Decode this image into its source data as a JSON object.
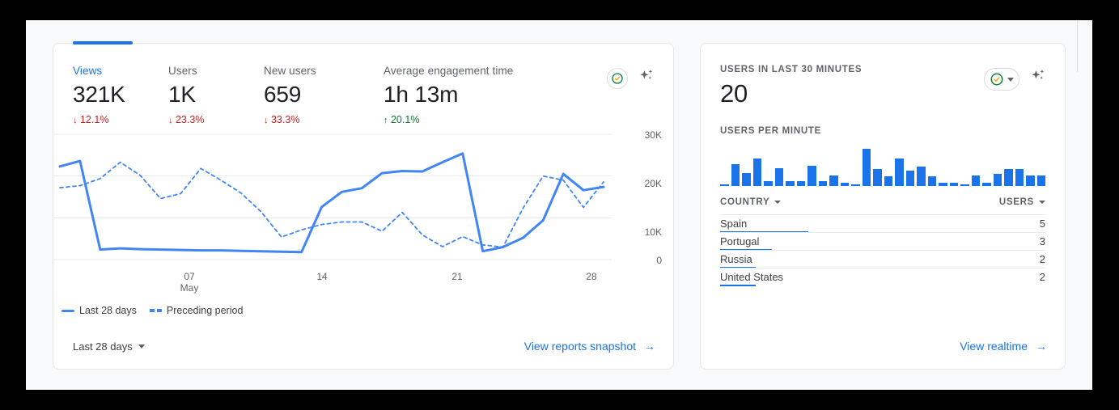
{
  "left_card": {
    "active_tab": "views",
    "metrics": [
      {
        "label": "Views",
        "value": "321K",
        "delta": "12.1%",
        "direction": "down",
        "arrow": "↓",
        "active": true
      },
      {
        "label": "Users",
        "value": "1K",
        "delta": "23.3%",
        "direction": "down",
        "arrow": "↓",
        "active": false
      },
      {
        "label": "New users",
        "value": "659",
        "delta": "33.3%",
        "direction": "down",
        "arrow": "↓",
        "active": false
      },
      {
        "label": "Average engagement time",
        "value": "1h 13m",
        "delta": "20.1%",
        "direction": "up",
        "arrow": "↑",
        "active": false
      }
    ],
    "icons": {
      "check": "check-circle-icon",
      "sparkle": "ai-sparkle-icon"
    },
    "legend": [
      {
        "label": "Last 28 days",
        "style": "solid"
      },
      {
        "label": "Preceding period",
        "style": "dashed"
      }
    ],
    "date_range": "Last 28 days",
    "footer_link": "View reports snapshot",
    "footer_link_arrow": "→"
  },
  "right_card": {
    "title": "USERS IN LAST 30 MINUTES",
    "value": "20",
    "subtitle": "USERS PER MINUTE",
    "icons": {
      "check": "check-circle-icon",
      "sparkle": "ai-sparkle-icon"
    },
    "table": {
      "columns": [
        "COUNTRY",
        "USERS"
      ],
      "rows": [
        {
          "country": "Spain",
          "users": "5",
          "bar_pct": 27
        },
        {
          "country": "Portugal",
          "users": "3",
          "bar_pct": 16
        },
        {
          "country": "Russia",
          "users": "2",
          "bar_pct": 11
        },
        {
          "country": "United States",
          "users": "2",
          "bar_pct": 11
        }
      ]
    },
    "footer_link": "View realtime",
    "footer_link_arrow": "→"
  },
  "colors": {
    "accent": "#1a73e8",
    "line": "#4285f4",
    "negative": "#c5221f",
    "positive": "#137333",
    "text": "#3c4043",
    "muted": "#5f6368",
    "page_bg": "#f8f9fa"
  },
  "chart_data": [
    {
      "type": "line",
      "title": "Views over time",
      "xlabel": "",
      "ylabel": "",
      "ylim": [
        0,
        30000
      ],
      "yticks": [
        0,
        10000,
        20000,
        30000
      ],
      "ytick_labels": [
        "0",
        "10K",
        "20K",
        "30K"
      ],
      "xticks": [
        6,
        13,
        20,
        27
      ],
      "xtick_labels": [
        "07",
        "14",
        "21",
        "28"
      ],
      "xtick_sublabel": "May",
      "grid": true,
      "legend_position": "bottom-left",
      "x": [
        0,
        1,
        2,
        3,
        4,
        5,
        6,
        7,
        8,
        9,
        10,
        11,
        12,
        13,
        14,
        15,
        16,
        17,
        18,
        19,
        20,
        21,
        22,
        23,
        24,
        25,
        26,
        27
      ],
      "series": [
        {
          "name": "Last 28 days",
          "style": "solid",
          "values": [
            22300,
            23600,
            2400,
            2700,
            2500,
            2400,
            2300,
            2200,
            2200,
            2100,
            2000,
            1900,
            1800,
            12600,
            16200,
            17100,
            20700,
            21200,
            21100,
            23300,
            25400,
            2000,
            3000,
            5200,
            9400,
            20500,
            16600,
            17400
          ]
        },
        {
          "name": "Preceding period",
          "style": "dashed",
          "values": [
            17200,
            17700,
            19400,
            23300,
            20100,
            14600,
            15800,
            21800,
            19000,
            15900,
            11400,
            5400,
            7100,
            8400,
            9000,
            9000,
            6800,
            11300,
            5900,
            3100,
            5500,
            3500,
            3000,
            12300,
            20000,
            19000,
            12500,
            18600
          ]
        }
      ]
    },
    {
      "type": "bar",
      "title": "Users per minute",
      "xlabel": "",
      "ylabel": "",
      "categories": [
        "1",
        "2",
        "3",
        "4",
        "5",
        "6",
        "7",
        "8",
        "9",
        "10",
        "11",
        "12",
        "13",
        "14",
        "15",
        "16",
        "17",
        "18",
        "19",
        "20",
        "21",
        "22",
        "23",
        "24",
        "25",
        "26",
        "27",
        "28",
        "29",
        "30"
      ],
      "values": [
        0,
        18,
        11,
        23,
        4,
        15,
        4,
        4,
        17,
        4,
        9,
        3,
        1,
        31,
        14,
        8,
        23,
        13,
        16,
        8,
        3,
        3,
        0,
        9,
        3,
        10,
        14,
        14,
        9,
        9
      ],
      "ylim": [
        0,
        31
      ]
    }
  ]
}
